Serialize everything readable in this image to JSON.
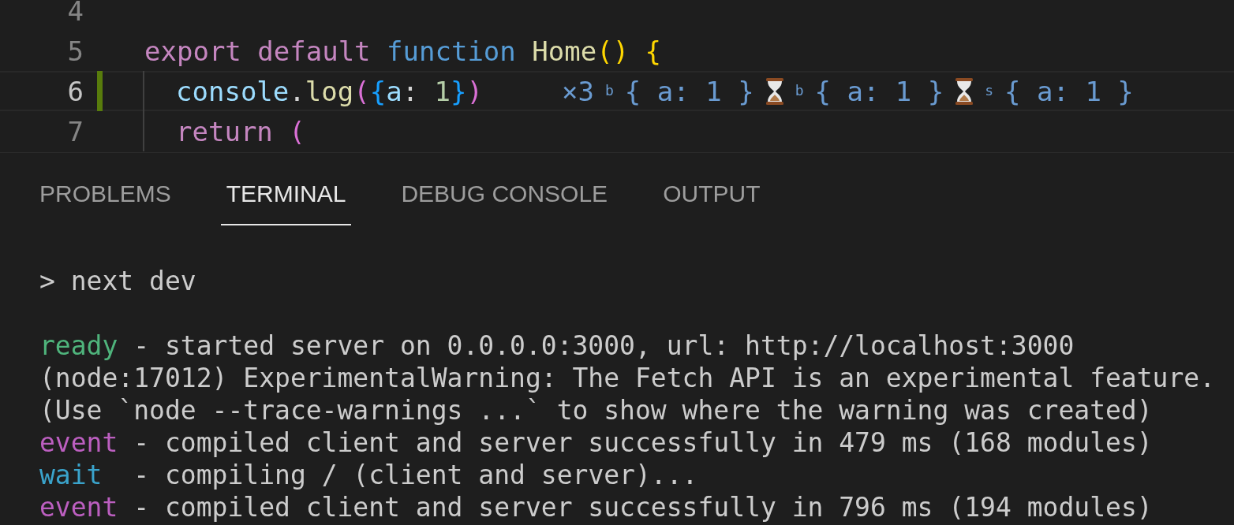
{
  "editor": {
    "lines": [
      {
        "number": "4",
        "current": false,
        "modified": false,
        "guide": false
      },
      {
        "number": "5",
        "current": false,
        "modified": false,
        "guide": false,
        "tokens": [
          {
            "kind": "keyword",
            "text": "export default "
          },
          {
            "kind": "storage",
            "text": "function "
          },
          {
            "kind": "function",
            "text": "Home"
          },
          {
            "kind": "bracket1",
            "text": "()"
          },
          {
            "kind": "bracket1",
            "text": " {"
          }
        ]
      },
      {
        "number": "6",
        "current": true,
        "modified": true,
        "guide": true,
        "tokens": [
          {
            "kind": "variable",
            "text": "console"
          },
          {
            "kind": "plain",
            "text": "."
          },
          {
            "kind": "function",
            "text": "log"
          },
          {
            "kind": "bracket2",
            "text": "("
          },
          {
            "kind": "bracket3",
            "text": "{"
          },
          {
            "kind": "variable",
            "text": "a"
          },
          {
            "kind": "plain",
            "text": ":"
          },
          {
            "kind": "number",
            "text": " 1"
          },
          {
            "kind": "bracket3",
            "text": "}"
          },
          {
            "kind": "bracket2",
            "text": ")"
          }
        ],
        "annotation": {
          "count": "×3",
          "items": [
            {
              "tag": "b",
              "value": "{ a: 1 }",
              "pending": true
            },
            {
              "tag": "b",
              "value": "{ a: 1 }",
              "pending": true
            },
            {
              "tag": "s",
              "value": "{ a: 1 }",
              "pending": false
            }
          ]
        }
      },
      {
        "number": "7",
        "current": false,
        "modified": false,
        "guide": true,
        "tokens": [
          {
            "kind": "keyword",
            "text": "return "
          },
          {
            "kind": "bracket2",
            "text": "("
          }
        ]
      }
    ]
  },
  "panel": {
    "tabs": [
      {
        "label": "PROBLEMS",
        "selected": false
      },
      {
        "label": "TERMINAL",
        "selected": true
      },
      {
        "label": "DEBUG CONSOLE",
        "selected": false
      },
      {
        "label": "OUTPUT",
        "selected": false
      }
    ],
    "terminal": {
      "command": "> next dev",
      "output": [
        {
          "segments": [
            {
              "kind": "ready",
              "text": "ready"
            },
            {
              "kind": "plain",
              "text": " - started server on 0.0.0.0:3000, url: http://localhost:3000"
            }
          ]
        },
        {
          "segments": [
            {
              "kind": "plain",
              "text": "(node:17012) ExperimentalWarning: The Fetch API is an experimental feature."
            }
          ]
        },
        {
          "segments": [
            {
              "kind": "plain",
              "text": "(Use `node --trace-warnings ...` to show where the warning was created)"
            }
          ]
        },
        {
          "segments": [
            {
              "kind": "event",
              "text": "event"
            },
            {
              "kind": "plain",
              "text": " - compiled client and server successfully in 479 ms (168 modules)"
            }
          ]
        },
        {
          "segments": [
            {
              "kind": "wait",
              "text": "wait"
            },
            {
              "kind": "plain",
              "text": "  - compiling / (client and server)..."
            }
          ]
        },
        {
          "segments": [
            {
              "kind": "event",
              "text": "event"
            },
            {
              "kind": "plain",
              "text": " - compiled client and server successfully in 796 ms (194 modules)"
            }
          ]
        }
      ]
    }
  }
}
